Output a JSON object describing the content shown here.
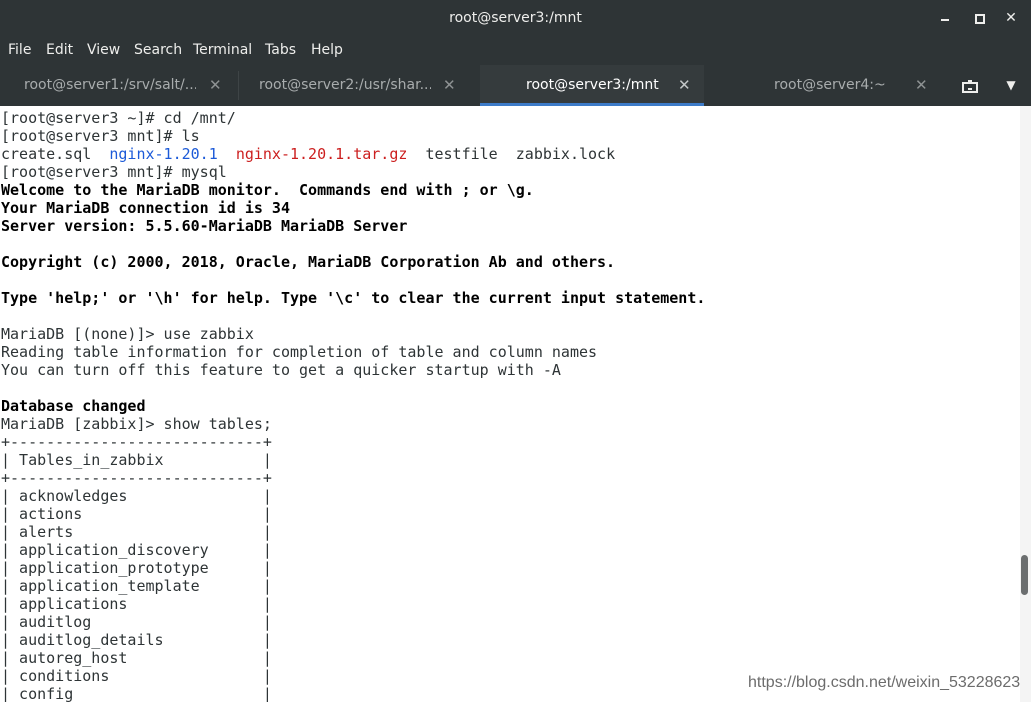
{
  "window": {
    "title": "root@server3:/mnt"
  },
  "menu": [
    "File",
    "Edit",
    "View",
    "Search",
    "Terminal",
    "Tabs",
    "Help"
  ],
  "tabs": [
    {
      "label": "root@server1:/srv/salt/...",
      "active": false
    },
    {
      "label": "root@server2:/usr/shar...",
      "active": false
    },
    {
      "label": "root@server3:/mnt",
      "active": true
    },
    {
      "label": "root@server4:~",
      "active": false
    }
  ],
  "terminal": {
    "lines": [
      {
        "text": "[root@server3 ~]# cd /mnt/"
      },
      {
        "text": "[root@server3 mnt]# ls"
      },
      {
        "segments": [
          {
            "text": "create.sql  "
          },
          {
            "text": "nginx-1.20.1",
            "color": "blue"
          },
          {
            "text": "  "
          },
          {
            "text": "nginx-1.20.1.tar.gz",
            "color": "red"
          },
          {
            "text": "  testfile  zabbix.lock"
          }
        ]
      },
      {
        "text": "[root@server3 mnt]# mysql"
      },
      {
        "text": "Welcome to the MariaDB monitor.  Commands end with ; or \\g.",
        "bold": true
      },
      {
        "text": "Your MariaDB connection id is 34",
        "bold": true
      },
      {
        "text": "Server version: 5.5.60-MariaDB MariaDB Server",
        "bold": true
      },
      {
        "text": ""
      },
      {
        "text": "Copyright (c) 2000, 2018, Oracle, MariaDB Corporation Ab and others.",
        "bold": true
      },
      {
        "text": ""
      },
      {
        "text": "Type 'help;' or '\\h' for help. Type '\\c' to clear the current input statement.",
        "bold": true
      },
      {
        "text": ""
      },
      {
        "text": "MariaDB [(none)]> use zabbix"
      },
      {
        "text": "Reading table information for completion of table and column names"
      },
      {
        "text": "You can turn off this feature to get a quicker startup with -A"
      },
      {
        "text": ""
      },
      {
        "text": "Database changed",
        "bold": true
      },
      {
        "text": "MariaDB [zabbix]> show tables;"
      },
      {
        "text": "+----------------------------+"
      },
      {
        "text": "| Tables_in_zabbix           |"
      },
      {
        "text": "+----------------------------+"
      },
      {
        "text": "| acknowledges               |"
      },
      {
        "text": "| actions                    |"
      },
      {
        "text": "| alerts                     |"
      },
      {
        "text": "| application_discovery      |"
      },
      {
        "text": "| application_prototype      |"
      },
      {
        "text": "| application_template       |"
      },
      {
        "text": "| applications               |"
      },
      {
        "text": "| auditlog                   |"
      },
      {
        "text": "| auditlog_details           |"
      },
      {
        "text": "| autoreg_host               |"
      },
      {
        "text": "| conditions                 |"
      },
      {
        "text": "| config                     |"
      }
    ]
  },
  "watermark": "https://blog.csdn.net/weixin_53228623",
  "colors": {
    "chrome_bg": "#2e3436",
    "terminal_bg": "#ffffff",
    "active_tab_underline": "#3d7bc8",
    "dir_blue": "#1c5ad8",
    "archive_red": "#cc1f1f"
  },
  "icons": {
    "minimize": "minimize-icon",
    "maximize": "maximize-icon",
    "close": "close-icon",
    "new_tab": "new-tab-icon",
    "tab_menu": "chevron-down-icon"
  }
}
